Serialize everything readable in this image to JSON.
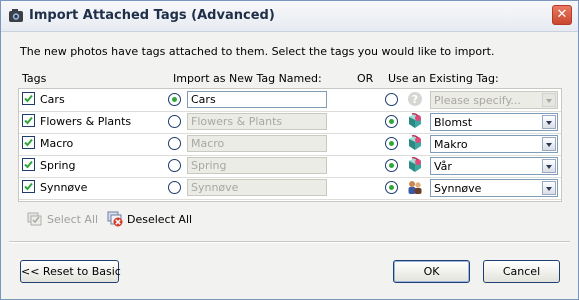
{
  "window": {
    "title": "Import Attached Tags (Advanced)",
    "icon": "tag-import-icon"
  },
  "intro": "The new photos have tags attached to them.  Select the tags you would like to import.",
  "columns": {
    "tags": "Tags",
    "new_tag": "Import as New Tag Named:",
    "or": "OR",
    "existing": "Use an Existing Tag:"
  },
  "rows": [
    {
      "checked": true,
      "name": "Cars",
      "mode": "new",
      "new_name": "Cars",
      "tag_icon": "question-icon",
      "existing": "Please specify..."
    },
    {
      "checked": true,
      "name": "Flowers & Plants",
      "mode": "existing",
      "new_name": "Flowers & Plants",
      "tag_icon": "tag-cube-icon",
      "existing": "Blomst"
    },
    {
      "checked": true,
      "name": "Macro",
      "mode": "existing",
      "new_name": "Macro",
      "tag_icon": "tag-cube-icon",
      "existing": "Makro"
    },
    {
      "checked": true,
      "name": "Spring",
      "mode": "existing",
      "new_name": "Spring",
      "tag_icon": "tag-cube-icon",
      "existing": "Vår"
    },
    {
      "checked": true,
      "name": "Synnøve",
      "mode": "existing",
      "new_name": "Synnøve",
      "tag_icon": "people-icon",
      "existing": "Synnøve"
    }
  ],
  "actions": {
    "select_all": "Select All",
    "deselect_all": "Deselect All"
  },
  "buttons": {
    "reset": "<< Reset to Basic",
    "ok": "OK",
    "cancel": "Cancel"
  },
  "colors": {
    "accent": "#31a63a",
    "title": "#1f2f49",
    "close": "#c9472e"
  }
}
